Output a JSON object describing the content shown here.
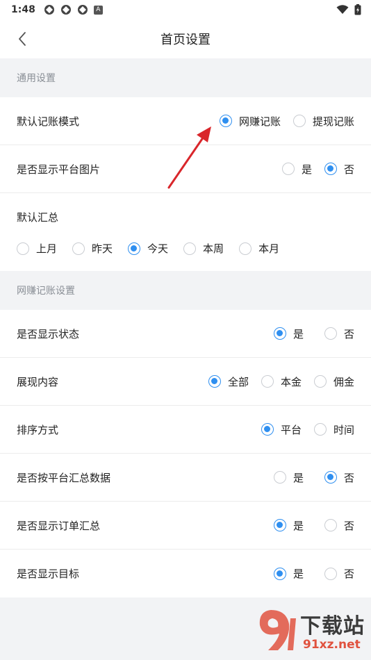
{
  "status": {
    "time": "1:48",
    "badge": "A"
  },
  "nav": {
    "title": "首页设置"
  },
  "sections": [
    {
      "header": "通用设置",
      "rows": [
        {
          "label": "默认记账模式",
          "options": [
            {
              "label": "网赚记账",
              "checked": true
            },
            {
              "label": "提现记账",
              "checked": false
            }
          ]
        },
        {
          "label": "是否显示平台图片",
          "options": [
            {
              "label": "是",
              "checked": false
            },
            {
              "label": "否",
              "checked": true
            }
          ]
        },
        {
          "label": "默认汇总",
          "options": [
            {
              "label": "上月",
              "checked": false
            },
            {
              "label": "昨天",
              "checked": false
            },
            {
              "label": "今天",
              "checked": true
            },
            {
              "label": "本周",
              "checked": false
            },
            {
              "label": "本月",
              "checked": false
            }
          ]
        }
      ]
    },
    {
      "header": "网赚记账设置",
      "rows": [
        {
          "label": "是否显示状态",
          "options": [
            {
              "label": "是",
              "checked": true
            },
            {
              "label": "否",
              "checked": false
            }
          ]
        },
        {
          "label": "展现内容",
          "options": [
            {
              "label": "全部",
              "checked": true
            },
            {
              "label": "本金",
              "checked": false
            },
            {
              "label": "佣金",
              "checked": false
            }
          ]
        },
        {
          "label": "排序方式",
          "options": [
            {
              "label": "平台",
              "checked": true
            },
            {
              "label": "时间",
              "checked": false
            }
          ]
        },
        {
          "label": "是否按平台汇总数据",
          "options": [
            {
              "label": "是",
              "checked": false
            },
            {
              "label": "否",
              "checked": true
            }
          ]
        },
        {
          "label": "是否显示订单汇总",
          "options": [
            {
              "label": "是",
              "checked": true
            },
            {
              "label": "否",
              "checked": false
            }
          ]
        },
        {
          "label": "是否显示目标",
          "options": [
            {
              "label": "是",
              "checked": true
            },
            {
              "label": "否",
              "checked": false
            }
          ]
        }
      ]
    }
  ],
  "watermark": {
    "big": "下载站",
    "small": "91xz.net"
  },
  "colors": {
    "accent": "#2f8ff0",
    "annotation": "#d9262b"
  }
}
